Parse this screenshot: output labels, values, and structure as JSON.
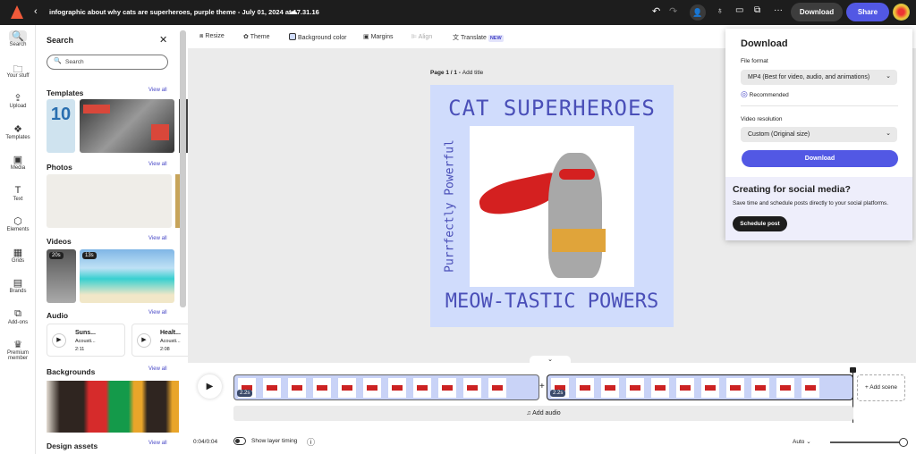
{
  "topbar": {
    "title": "infographic about why cats are superheroes, purple theme - July 01, 2024 at 17.31.16",
    "download": "Download",
    "share": "Share",
    "icons": [
      "back-icon",
      "cloud-icon",
      "undo-icon",
      "redo-icon",
      "invite-icon",
      "lightbulb-icon",
      "comment-icon",
      "feedback-icon",
      "more-icon"
    ]
  },
  "rail": [
    {
      "label": "Search",
      "icon": "🔍"
    },
    {
      "label": "Your stuff",
      "icon": "🗀"
    },
    {
      "label": "Upload",
      "icon": "⇪"
    },
    {
      "label": "Templates",
      "icon": "❖"
    },
    {
      "label": "Media",
      "icon": "▣"
    },
    {
      "label": "Text",
      "icon": "T"
    },
    {
      "label": "Elements",
      "icon": "⬡"
    },
    {
      "label": "Grids",
      "icon": "▦"
    },
    {
      "label": "Brands",
      "icon": "▤"
    },
    {
      "label": "Add-ons",
      "icon": "⧉"
    },
    {
      "label": "Premium member",
      "icon": "♛"
    }
  ],
  "panel": {
    "title": "Search",
    "search_placeholder": "Search",
    "view_all": "View all",
    "sections": {
      "templates": "Templates",
      "photos": "Photos",
      "videos": "Videos",
      "audio": "Audio",
      "backgrounds": "Backgrounds",
      "design_assets": "Design assets"
    },
    "template_thumb_text": "10",
    "videos": [
      "20s",
      "13s"
    ],
    "audio": [
      {
        "title": "Suns...",
        "artist": "Acousti...",
        "duration": "2:11"
      },
      {
        "title": "Healt...",
        "artist": "Acousti...",
        "duration": "2:08"
      }
    ]
  },
  "toolbar": {
    "resize": "Resize",
    "theme": "Theme",
    "background_color": "Background color",
    "margins": "Margins",
    "align": "Align",
    "translate": "Translate",
    "new_badge": "NEW"
  },
  "canvas": {
    "page_label": "Page 1 / 1 - ",
    "add_title": "Add title",
    "design": {
      "title": "CAT SUPERHEROES",
      "side": "Purrfectly Powerful",
      "bottom": "MEOW-TASTIC POWERS",
      "bg": "#d0dcfc",
      "text_color": "#4a4fb8"
    }
  },
  "download_panel": {
    "title": "Download",
    "file_format_label": "File format",
    "file_format": "MP4 (Best for video, audio, and animations)",
    "recommended": "Recommended",
    "resolution_label": "Video resolution",
    "resolution": "Custom (Original size)",
    "download_button": "Download",
    "social_title": "Creating for social media?",
    "social_text": "Save time and schedule posts directly to your social platforms.",
    "schedule_button": "Schedule post",
    "accent": "#5258e4"
  },
  "timeline": {
    "scenes": [
      {
        "duration": "2.2s"
      },
      {
        "duration": "2.2s"
      }
    ],
    "add_scene": "+ Add scene",
    "add_audio": "Add audio",
    "time": "0:04/0:04",
    "show_layer_timing": "Show layer timing",
    "zoom_mode": "Auto",
    "zoom_level": 1.0
  }
}
